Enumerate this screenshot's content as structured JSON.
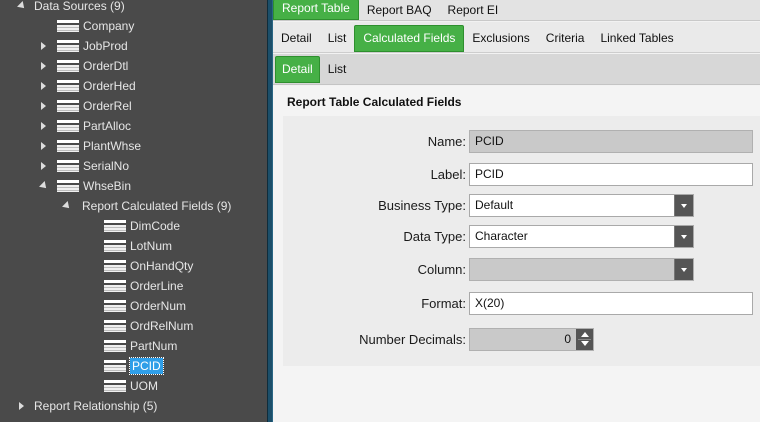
{
  "tree": {
    "items": [
      {
        "label": "Data Sources (9)",
        "expander": "down",
        "icon": false
      },
      {
        "label": "Company",
        "expander": "none",
        "icon": true
      },
      {
        "label": "JobProd",
        "expander": "right",
        "icon": true
      },
      {
        "label": "OrderDtl",
        "expander": "right",
        "icon": true
      },
      {
        "label": "OrderHed",
        "expander": "right",
        "icon": true
      },
      {
        "label": "OrderRel",
        "expander": "right",
        "icon": true
      },
      {
        "label": "PartAlloc",
        "expander": "right",
        "icon": true
      },
      {
        "label": "PlantWhse",
        "expander": "right",
        "icon": true
      },
      {
        "label": "SerialNo",
        "expander": "right",
        "icon": true
      },
      {
        "label": "WhseBin",
        "expander": "down",
        "icon": true
      },
      {
        "label": "Report Calculated Fields (9)",
        "expander": "down",
        "icon": false
      },
      {
        "label": "DimCode",
        "expander": "none",
        "icon": true
      },
      {
        "label": "LotNum",
        "expander": "none",
        "icon": true
      },
      {
        "label": "OnHandQty",
        "expander": "none",
        "icon": true
      },
      {
        "label": "OrderLine",
        "expander": "none",
        "icon": true
      },
      {
        "label": "OrderNum",
        "expander": "none",
        "icon": true
      },
      {
        "label": "OrdRelNum",
        "expander": "none",
        "icon": true
      },
      {
        "label": "PartNum",
        "expander": "none",
        "icon": true
      },
      {
        "label": "PCID",
        "expander": "none",
        "icon": true,
        "selected": true
      },
      {
        "label": "UOM",
        "expander": "none",
        "icon": true
      },
      {
        "label": "Report Relationship (5)",
        "expander": "right",
        "icon": false
      }
    ]
  },
  "top_tabs": [
    {
      "label": "Report Table",
      "active": true
    },
    {
      "label": "Report BAQ",
      "active": false
    },
    {
      "label": "Report EI",
      "active": false
    }
  ],
  "sub_tabs": [
    {
      "label": "Detail",
      "active": false
    },
    {
      "label": "List",
      "active": false
    },
    {
      "label": "Calculated Fields",
      "active": true
    },
    {
      "label": "Exclusions",
      "active": false
    },
    {
      "label": "Criteria",
      "active": false
    },
    {
      "label": "Linked Tables",
      "active": false
    }
  ],
  "detail_tabs": [
    {
      "label": "Detail",
      "active": true
    },
    {
      "label": "List",
      "active": false
    }
  ],
  "panel": {
    "title": "Report Table Calculated Fields",
    "fields": {
      "name": {
        "label": "Name:",
        "value": "PCID"
      },
      "label": {
        "label": "Label:",
        "value": "PCID"
      },
      "business_type": {
        "label": "Business Type:",
        "value": "Default"
      },
      "data_type": {
        "label": "Data Type:",
        "value": "Character"
      },
      "column": {
        "label": "Column:",
        "value": ""
      },
      "format": {
        "label": "Format:",
        "value": "X(20)"
      },
      "number_decimals": {
        "label": "Number Decimals:",
        "value": "0"
      }
    }
  },
  "colors": {
    "active_tab": "#46b046",
    "selection": "#2f9ee8",
    "tree_bg": "#4a4a4a"
  }
}
